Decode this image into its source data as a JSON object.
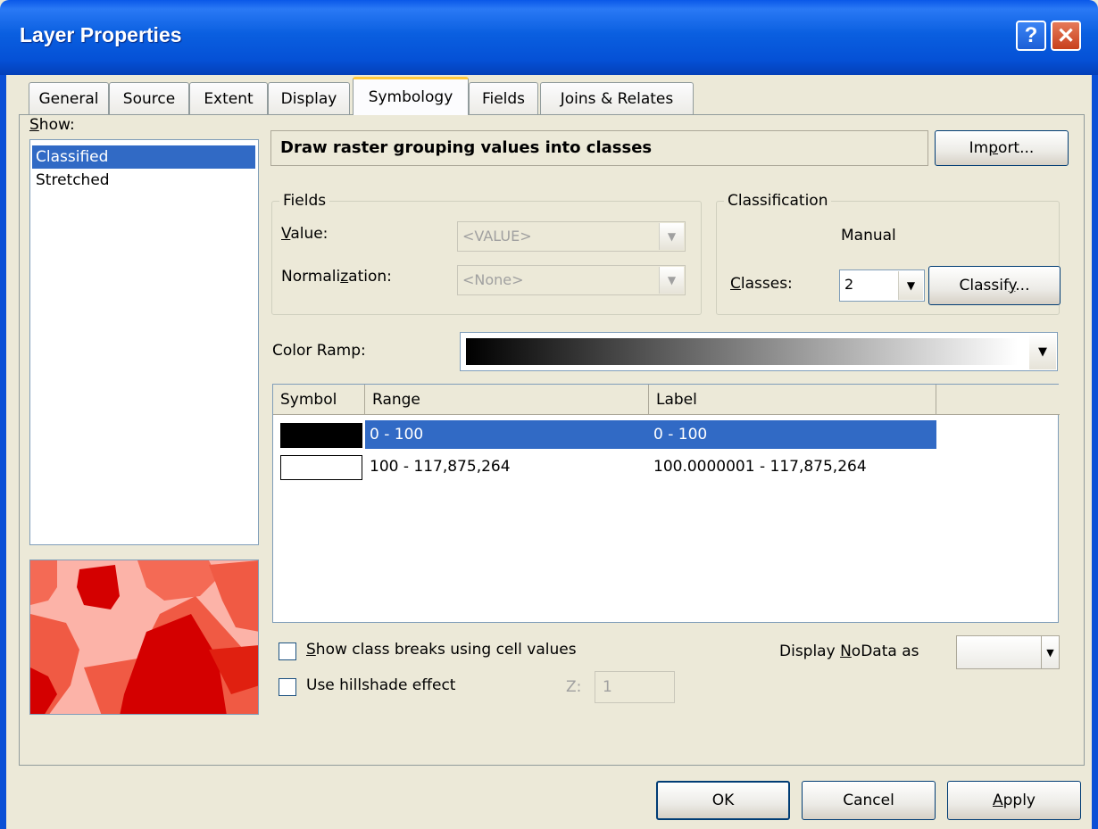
{
  "window": {
    "title": "Layer Properties",
    "help_glyph": "?",
    "close_glyph": "✕"
  },
  "tabs": [
    {
      "label": "General"
    },
    {
      "label": "Source"
    },
    {
      "label": "Extent"
    },
    {
      "label": "Display"
    },
    {
      "label": "Symbology",
      "active": true
    },
    {
      "label": "Fields"
    },
    {
      "label": "Joins & Relates"
    }
  ],
  "show": {
    "label_first": "S",
    "label_rest": "how:",
    "items": [
      {
        "label": "Classified",
        "selected": true
      },
      {
        "label": "Stretched"
      }
    ]
  },
  "header": {
    "title": "Draw raster grouping values into classes"
  },
  "import_button": {
    "pre": "Im",
    "u": "p",
    "post": "ort..."
  },
  "fields": {
    "legend": "Fields",
    "value_label_u": "V",
    "value_label_rest": "alue:",
    "value_selected": "<VALUE>",
    "normalization_label_pre": "Normali",
    "normalization_label_u": "z",
    "normalization_label_post": "ation:",
    "normalization_selected": "<None>"
  },
  "classification": {
    "legend": "Classification",
    "method": "Manual",
    "classes_label_u": "C",
    "classes_label_rest": "lasses:",
    "classes_value": "2",
    "classify_pre": "Classif",
    "classify_u": "y",
    "classify_post": "..."
  },
  "color_ramp": {
    "label": "Color Ramp:",
    "start_color": "#000000",
    "end_color": "#ffffff"
  },
  "table": {
    "columns": [
      "Symbol",
      "Range",
      "Label"
    ],
    "rows": [
      {
        "symbol_color": "#000000",
        "range": "0 - 100",
        "label": "0 - 100",
        "selected": true
      },
      {
        "symbol_color": "#ffffff",
        "range": "100 - 117,875,264",
        "label": "100.0000001 - 117,875,264",
        "selected": false
      }
    ]
  },
  "options": {
    "show_breaks_u": "S",
    "show_breaks_rest": "how class breaks using cell values",
    "show_breaks_checked": false,
    "hillshade_label": "Use hillshade effect",
    "hillshade_checked": false,
    "z_label": "Z:",
    "z_value": "1",
    "nodata_pre": "Display ",
    "nodata_u": "N",
    "nodata_post": "oData as"
  },
  "buttons": {
    "ok": "OK",
    "cancel": "Cancel",
    "apply_u": "A",
    "apply_rest": "pply"
  },
  "colors": {
    "titlebar": "#0a58e8",
    "selection": "#316ac5",
    "dialog_bg": "#ece9d8",
    "preview_light": "#fcb3a8",
    "preview_mid": "#f05a44",
    "preview_dark": "#d40000"
  }
}
